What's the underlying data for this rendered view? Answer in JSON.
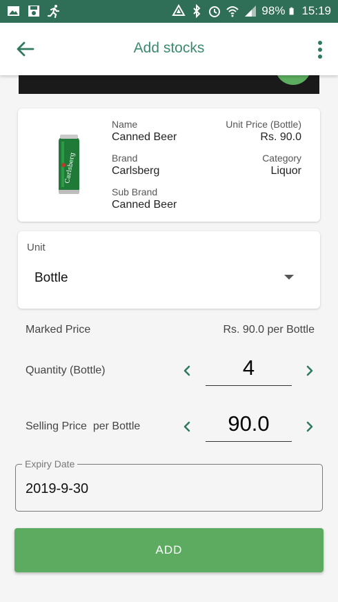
{
  "status_bar": {
    "battery": "98%",
    "time": "15:19"
  },
  "app_bar": {
    "title": "Add stocks"
  },
  "product": {
    "name_label": "Name",
    "name_value": "Canned Beer",
    "price_label": "Unit Price (Bottle)",
    "price_value": "Rs. 90.0",
    "brand_label": "Brand",
    "brand_value": "Carlsberg",
    "category_label": "Category",
    "category_value": "Liquor",
    "subbrand_label": "Sub Brand",
    "subbrand_value": "Canned Beer"
  },
  "unit": {
    "label": "Unit",
    "selected": "Bottle"
  },
  "marked_price": {
    "label": "Marked Price",
    "value": "Rs. 90.0 per Bottle"
  },
  "quantity": {
    "label": "Quantity (Bottle)",
    "value": "4"
  },
  "selling_price": {
    "label": "Selling Price  per Bottle",
    "value": "90.0"
  },
  "expiry": {
    "label": "Expiry Date",
    "value": "2019-9-30"
  },
  "add_button": {
    "label": "ADD"
  },
  "colors": {
    "statusbar": "#2f6e57",
    "accent": "#3a8b6d",
    "button": "#5dab60"
  }
}
